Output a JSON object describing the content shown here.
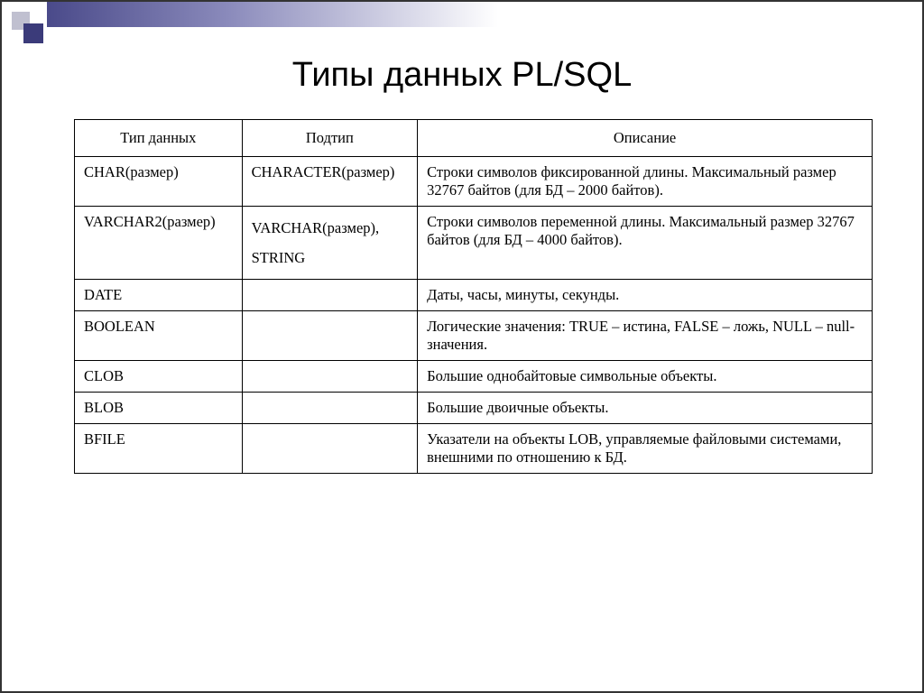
{
  "title": "Типы данных PL/SQL",
  "headers": {
    "col1": "Тип данных",
    "col2": "Подтип",
    "col3": "Описание"
  },
  "rows": [
    {
      "type": "CHAR(размер)",
      "subtype": "CHARACTER(размер)",
      "description": "Строки символов фиксированной длины. Максимальный размер 32767 байтов (для БД – 2000 байтов)."
    },
    {
      "type": "VARCHAR2(размер)",
      "subtype": "VARCHAR(размер), STRING",
      "description": "Строки символов переменной длины. Максимальный размер 32767 байтов (для БД – 4000 байтов)."
    },
    {
      "type": "DATE",
      "subtype": "",
      "description": "Даты, часы, минуты, секунды."
    },
    {
      "type": "BOOLEAN",
      "subtype": "",
      "description": "Логические значения: TRUE – истина, FALSE – ложь, NULL – null-значения."
    },
    {
      "type": "CLOB",
      "subtype": "",
      "description": "Большие однобайтовые символьные объекты."
    },
    {
      "type": "BLOB",
      "subtype": "",
      "description": "Большие двоичные объекты."
    },
    {
      "type": "BFILE",
      "subtype": "",
      "description": "Указатели на объекты LOB, управляемые файловыми системами, внешними по отношению к БД."
    }
  ]
}
